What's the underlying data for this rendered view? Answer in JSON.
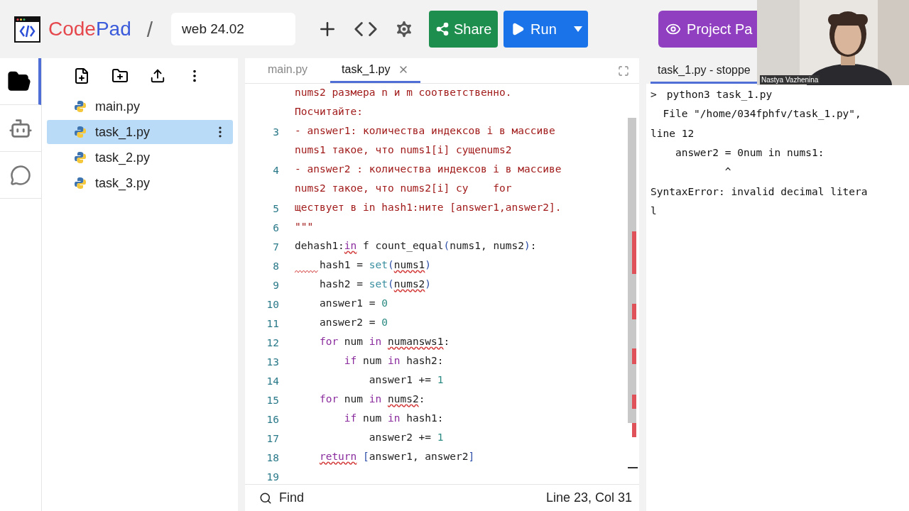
{
  "header": {
    "logo_parts": [
      {
        "text": "Code",
        "color": "#e5484d"
      },
      {
        "text": "Pad",
        "color": "#3b5bdb"
      }
    ],
    "separator": "/",
    "project_name": "web 24.02",
    "share": "Share",
    "run": "Run",
    "project_page": "Project Pa"
  },
  "rail": [
    {
      "kind": "files",
      "selected": true
    },
    {
      "kind": "assistant",
      "selected": false
    },
    {
      "kind": "chat",
      "selected": false
    }
  ],
  "files": [
    {
      "name": "main.py",
      "selected": false
    },
    {
      "name": "task_1.py",
      "selected": true
    },
    {
      "name": "task_2.py",
      "selected": false
    },
    {
      "name": "task_3.py",
      "selected": false
    }
  ],
  "editor_tabs": [
    {
      "label": "main.py",
      "selected": false,
      "closable": false
    },
    {
      "label": "task_1.py",
      "selected": true,
      "closable": true
    }
  ],
  "code": [
    {
      "segments": [
        {
          "kind": "string",
          "text": "nums2 размера n и m соответственно."
        }
      ]
    },
    {
      "segments": [
        {
          "kind": "string",
          "text": "Посчитайте:"
        }
      ]
    },
    {
      "number": "3",
      "segments": [
        {
          "kind": "string",
          "text": "- answer1: количества индексов i в массиве"
        }
      ]
    },
    {
      "segments": [
        {
          "kind": "string",
          "text": "nums1 такое, что nums1[i] сущеnums2"
        }
      ]
    },
    {
      "number": "4",
      "segments": [
        {
          "kind": "string",
          "text": "- answer2 : количества индексов i в массиве"
        }
      ]
    },
    {
      "segments": [
        {
          "kind": "string",
          "text": "nums2 такое, что nums2[i] су    for"
        }
      ]
    },
    {
      "number": "5",
      "segments": [
        {
          "kind": "string",
          "text": "ществует в in hash1:ните [answer1,answer2]."
        }
      ]
    },
    {
      "number": "6",
      "segments": [
        {
          "kind": "string",
          "text": "\"\"\""
        }
      ]
    },
    {
      "number": "7",
      "segments": [
        {
          "kind": "plain",
          "text": "dehash1:"
        },
        {
          "kind": "keyword",
          "text": "in",
          "error": true
        },
        {
          "kind": "plain",
          "text": " f count_equal"
        },
        {
          "kind": "paren",
          "text": "("
        },
        {
          "kind": "plain",
          "text": "nums1, nums2"
        },
        {
          "kind": "paren",
          "text": ")"
        },
        {
          "kind": "plain",
          "text": ":"
        }
      ]
    },
    {
      "number": "8",
      "indent_error": true,
      "segments": [
        {
          "kind": "plain",
          "text": "    hash1 = "
        },
        {
          "kind": "builtin",
          "text": "set"
        },
        {
          "kind": "paren",
          "text": "("
        },
        {
          "kind": "plain",
          "text": "nums1",
          "error": true
        },
        {
          "kind": "paren",
          "text": ")"
        }
      ]
    },
    {
      "number": "9",
      "segments": [
        {
          "kind": "plain",
          "text": "    hash2 = "
        },
        {
          "kind": "builtin",
          "text": "set"
        },
        {
          "kind": "paren",
          "text": "("
        },
        {
          "kind": "plain",
          "text": "nums2",
          "error": true
        },
        {
          "kind": "paren",
          "text": ")"
        }
      ]
    },
    {
      "number": "10",
      "segments": [
        {
          "kind": "plain",
          "text": "    answer1 = "
        },
        {
          "kind": "number",
          "text": "0"
        }
      ]
    },
    {
      "number": "11",
      "segments": [
        {
          "kind": "plain",
          "text": "    answer2 = "
        },
        {
          "kind": "number",
          "text": "0"
        }
      ]
    },
    {
      "number": "12",
      "segments": [
        {
          "kind": "keyword",
          "text": "    for"
        },
        {
          "kind": "plain",
          "text": " num "
        },
        {
          "kind": "keyword",
          "text": "in "
        },
        {
          "kind": "plain",
          "text": "numansws1",
          "error": true
        },
        {
          "kind": "plain",
          "text": ":"
        }
      ]
    },
    {
      "number": "13",
      "segments": [
        {
          "kind": "keyword",
          "text": "        if"
        },
        {
          "kind": "plain",
          "text": " num "
        },
        {
          "kind": "keyword",
          "text": "in"
        },
        {
          "kind": "plain",
          "text": " hash2:"
        }
      ]
    },
    {
      "number": "14",
      "segments": [
        {
          "kind": "plain",
          "text": "            answer1 += "
        },
        {
          "kind": "number",
          "text": "1"
        }
      ]
    },
    {
      "number": "15",
      "segments": [
        {
          "kind": "keyword",
          "text": "    for"
        },
        {
          "kind": "plain",
          "text": " num "
        },
        {
          "kind": "keyword",
          "text": "in "
        },
        {
          "kind": "plain",
          "text": "nums2",
          "error": true
        },
        {
          "kind": "plain",
          "text": ":"
        }
      ]
    },
    {
      "number": "16",
      "segments": [
        {
          "kind": "keyword",
          "text": "        if"
        },
        {
          "kind": "plain",
          "text": " num "
        },
        {
          "kind": "keyword",
          "text": "in"
        },
        {
          "kind": "plain",
          "text": " hash1:"
        }
      ]
    },
    {
      "number": "17",
      "segments": [
        {
          "kind": "plain",
          "text": "            answer2 += "
        },
        {
          "kind": "number",
          "text": "1"
        }
      ]
    },
    {
      "number": "18",
      "segments": [
        {
          "kind": "keyword",
          "text": "    return",
          "error": true
        },
        {
          "kind": "paren",
          "text": " ["
        },
        {
          "kind": "plain",
          "text": "answer1, answer2"
        },
        {
          "kind": "paren",
          "text": "]"
        }
      ]
    },
    {
      "number": "19"
    }
  ],
  "status_bar": {
    "find": "Find",
    "position": "Line 23, Col 31"
  },
  "terminal": {
    "tab": "task_1.py - stoppe",
    "prompt": ">",
    "lines": [
      "python3 task_1.py",
      "  File \"/home/034fphfv/task_1.py\",",
      "line 12",
      "    answer2 = 0num in nums1:",
      "            ^",
      "SyntaxError: invalid decimal litera",
      "l"
    ]
  },
  "video": {
    "caption": "Nastya Vazhenina"
  }
}
